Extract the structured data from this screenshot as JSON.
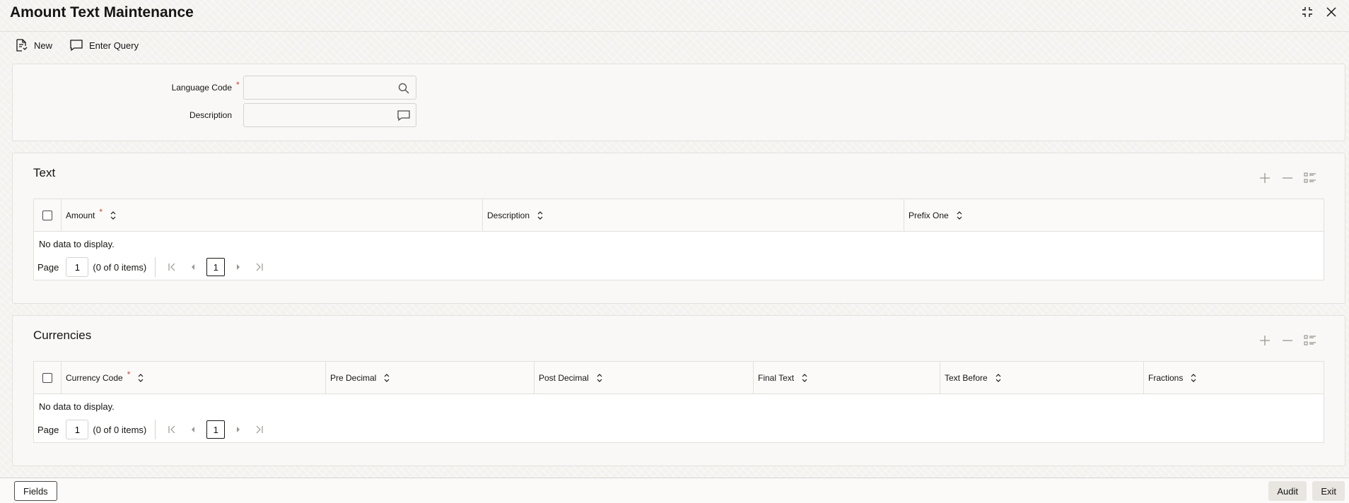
{
  "window": {
    "title": "Amount Text Maintenance"
  },
  "toolbar": {
    "new_label": "New",
    "enter_query_label": "Enter Query"
  },
  "form": {
    "language_code_label": "Language Code",
    "language_code_value": "",
    "description_label": "Description",
    "description_value": "",
    "required_mark": "*"
  },
  "text_section": {
    "title": "Text",
    "columns": [
      "Amount",
      "Description",
      "Prefix One"
    ],
    "required_mark": "*",
    "empty_message": "No data to display.",
    "pager": {
      "page_label": "Page",
      "page_value": "1",
      "count_text": "(0 of 0 items)",
      "current_page": "1"
    }
  },
  "currencies_section": {
    "title": "Currencies",
    "columns": [
      "Currency Code",
      "Pre Decimal",
      "Post Decimal",
      "Final Text",
      "Text Before",
      "Fractions"
    ],
    "required_mark": "*",
    "empty_message": "No data to display.",
    "pager": {
      "page_label": "Page",
      "page_value": "1",
      "count_text": "(0 of 0 items)",
      "current_page": "1"
    }
  },
  "footer": {
    "fields_label": "Fields",
    "audit_label": "Audit",
    "exit_label": "Exit"
  },
  "icons": {
    "minimize": "collapse-icon",
    "close": "close-icon",
    "new": "new-document-icon",
    "enter_query": "chat-bubble-icon",
    "lov": "search-icon",
    "description_popup": "chat-bubble-icon",
    "add_row": "plus-icon",
    "delete_row": "minus-icon",
    "single_view": "list-icon"
  },
  "colors": {
    "required": "#c74634",
    "text": "#161513",
    "border": "#e3e0dc"
  }
}
